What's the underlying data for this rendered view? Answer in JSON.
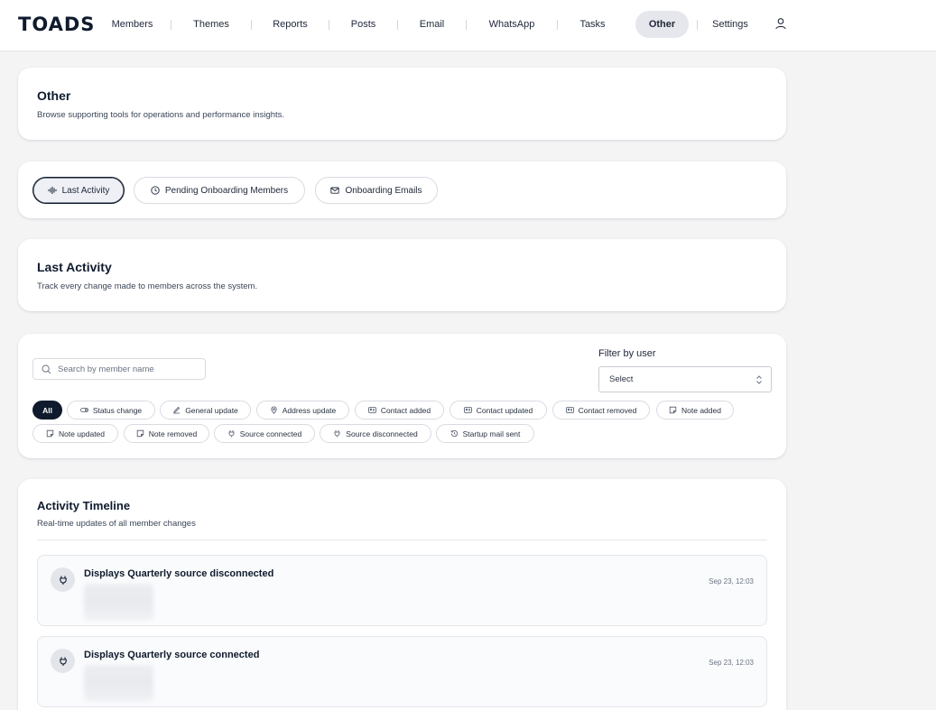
{
  "app": {
    "logo": "TOADS"
  },
  "nav": {
    "items": [
      {
        "label": "Members"
      },
      {
        "label": "Themes"
      },
      {
        "label": "Reports"
      },
      {
        "label": "Posts"
      },
      {
        "label": "Email"
      },
      {
        "label": "WhatsApp"
      },
      {
        "label": "Tasks"
      },
      {
        "label": "Other",
        "active": true
      },
      {
        "label": "Settings"
      }
    ],
    "user_icon": "user-icon"
  },
  "header": {
    "title": "Other",
    "subtitle": "Browse supporting tools for operations and performance insights."
  },
  "tabs": [
    {
      "label": "Last Activity",
      "icon": "activity-icon",
      "active": true
    },
    {
      "label": "Pending Onboarding Members",
      "icon": "clock-icon"
    },
    {
      "label": "Onboarding Emails",
      "icon": "mail-icon"
    }
  ],
  "section": {
    "title": "Last Activity",
    "subtitle": "Track every change made to members across the system."
  },
  "filters": {
    "search_placeholder": "Search by member name",
    "filter_label": "Filter by user",
    "select_value": "Select",
    "chips": [
      {
        "label": "All",
        "active": true
      },
      {
        "label": "Status change",
        "icon": "toggle-icon"
      },
      {
        "label": "General update",
        "icon": "edit-icon"
      },
      {
        "label": "Address update",
        "icon": "pin-icon"
      },
      {
        "label": "Contact added",
        "icon": "contact-card-icon"
      },
      {
        "label": "Contact updated",
        "icon": "contact-card-icon"
      },
      {
        "label": "Contact removed",
        "icon": "contact-card-icon"
      },
      {
        "label": "Note added",
        "icon": "note-icon"
      },
      {
        "label": "Note updated",
        "icon": "note-icon"
      },
      {
        "label": "Note removed",
        "icon": "note-icon"
      },
      {
        "label": "Source connected",
        "icon": "plug-icon"
      },
      {
        "label": "Source disconnected",
        "icon": "plug-icon"
      },
      {
        "label": "Startup mail sent",
        "icon": "history-icon"
      }
    ]
  },
  "timeline": {
    "title": "Activity Timeline",
    "subtitle": "Real-time updates of all member changes",
    "entries": [
      {
        "title": "Displays Quarterly source disconnected",
        "time": "Sep 23, 12:03",
        "icon": "plug-icon"
      },
      {
        "title": "Displays Quarterly source connected",
        "time": "Sep 23, 12:03",
        "icon": "plug-icon"
      }
    ]
  }
}
